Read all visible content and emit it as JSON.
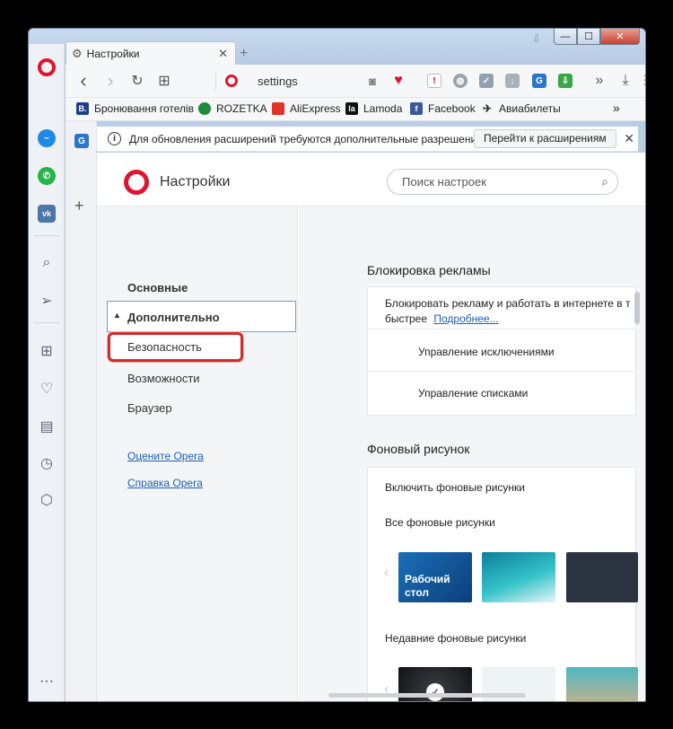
{
  "tab": {
    "title": "Настройки",
    "gear_icon": "gear-icon",
    "close": "✕",
    "new_tab": "+"
  },
  "window_controls": {
    "minimize": "—",
    "maximize": "☐",
    "close": "✕"
  },
  "toolbar": {
    "address": "settings",
    "back": "‹",
    "forward": "›",
    "reload": "↻",
    "tabs": "⊞",
    "more": "»",
    "download": "⤓",
    "menu": "☰"
  },
  "bookmarks": [
    {
      "label": "Бронювання готелів",
      "icon": "booking-icon",
      "color": "#1f3f8a",
      "glyph": "B."
    },
    {
      "label": "ROZETKA",
      "icon": "rozetka-icon",
      "color": "#1e8a3a",
      "glyph": ""
    },
    {
      "label": "AliExpress",
      "icon": "aliexpress-icon",
      "color": "#e43226",
      "glyph": ""
    },
    {
      "label": "Lamoda",
      "icon": "lamoda-icon",
      "color": "#111111",
      "glyph": "la"
    },
    {
      "label": "Facebook",
      "icon": "facebook-icon",
      "color": "#3b5998",
      "glyph": "f"
    },
    {
      "label": "Авиабилеты",
      "icon": "plane-icon",
      "color": "#ffffff",
      "glyph": "✈"
    }
  ],
  "bookmarks_more": "»",
  "notification": {
    "message": "Для обновления расширений требуются дополнительные разрешения...",
    "button": "Перейти к расширениям",
    "close": "✕",
    "info": "i"
  },
  "settings": {
    "title": "Настройки",
    "search_placeholder": "Поиск настроек"
  },
  "nav": {
    "basic": "Основные",
    "advanced": "Дополнительно",
    "security": "Безопасность",
    "features": "Возможности",
    "browser": "Браузер",
    "rate": "Оцените Opera",
    "help": "Справка Opera"
  },
  "ad_block": {
    "title": "Блокировка рекламы",
    "description": "Блокировать рекламу и работать в интернете в т",
    "description2": "быстрее",
    "more_link": "Подробнее...",
    "exceptions": "Управление исключениями",
    "lists": "Управление списками"
  },
  "wallpapers": {
    "title": "Фоновый рисунок",
    "enable": "Включить фоновые рисунки",
    "all": "Все фоновые рисунки",
    "recent": "Недавние фоновые рисунки",
    "desktop_thumb_label": "Рабочий стол"
  }
}
